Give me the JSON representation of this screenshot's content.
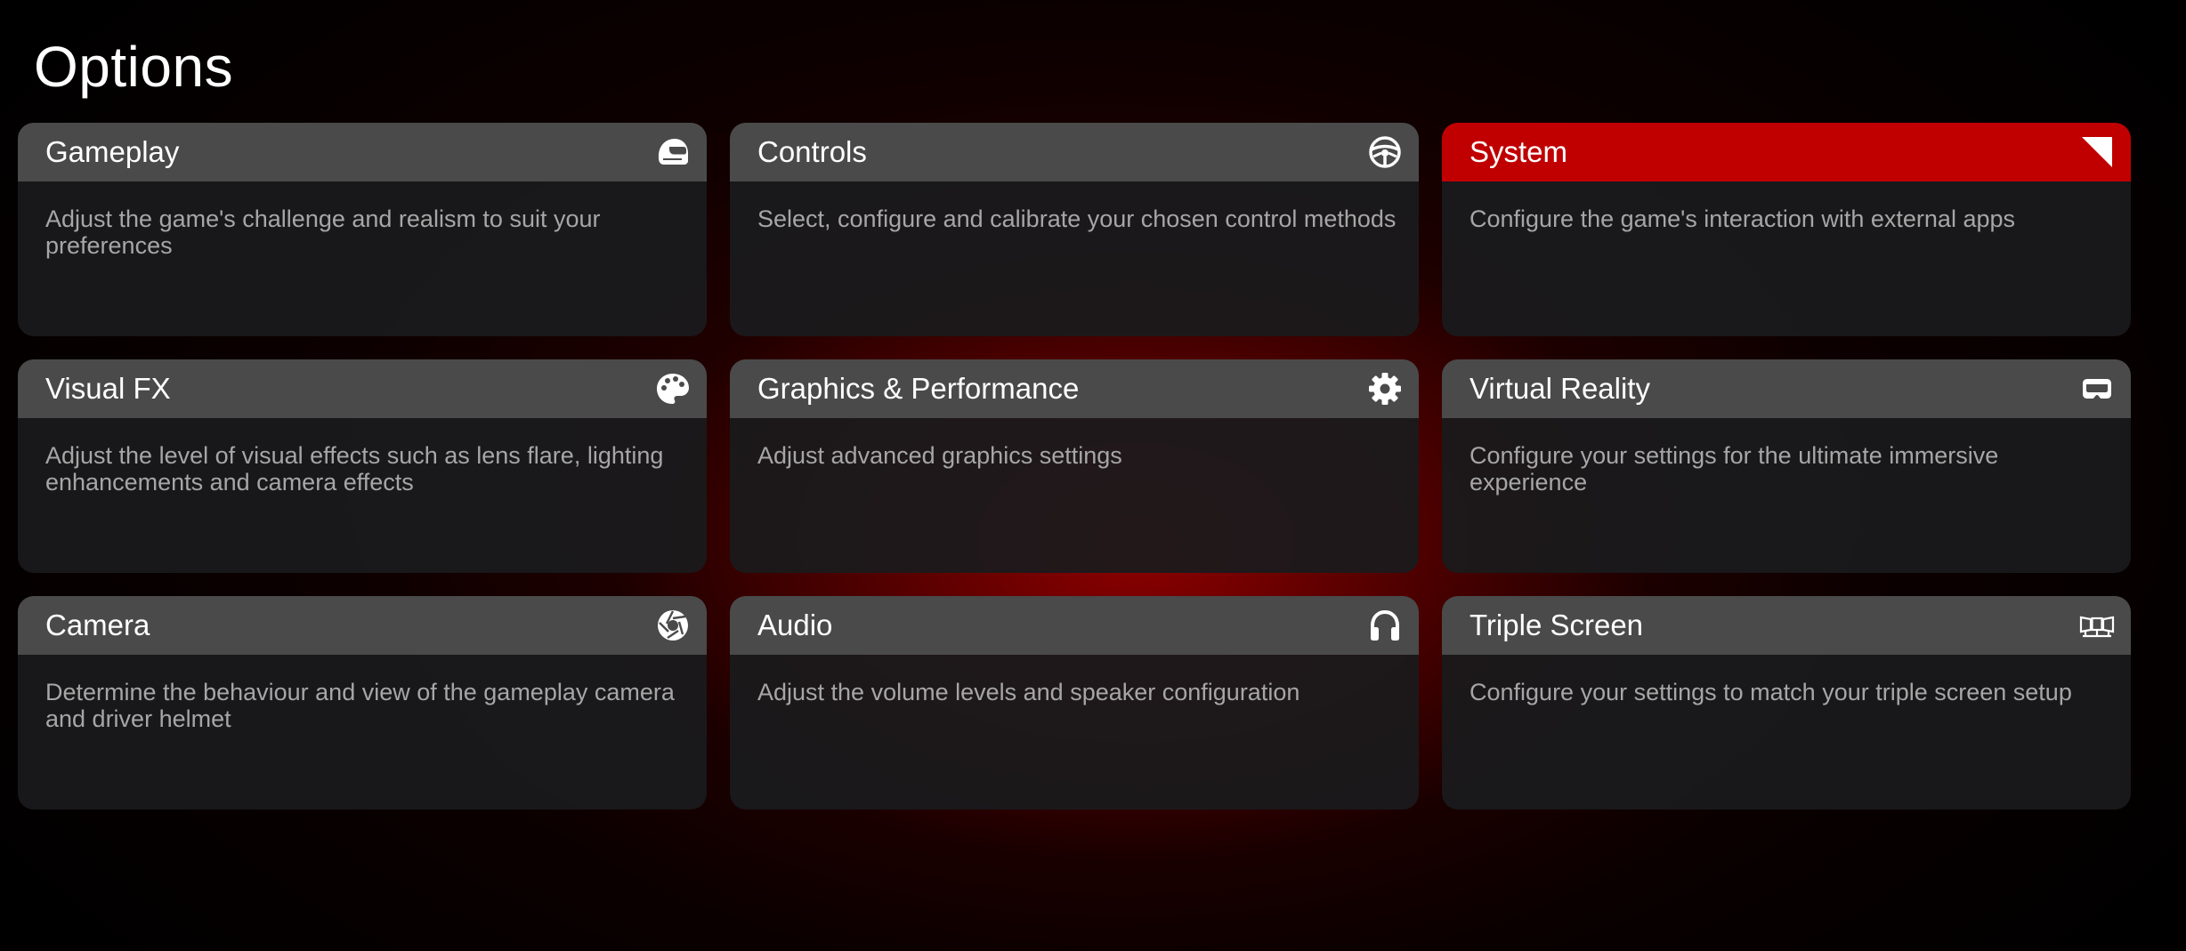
{
  "page": {
    "title": "Options"
  },
  "colors": {
    "selected_header": "#c00000",
    "header": "#4a4a4a",
    "card_body": "#1a1a1c",
    "description_text": "#a6a6a6"
  },
  "cards": [
    {
      "title": "Gameplay",
      "icon": "helmet-icon",
      "description": "Adjust the game's challenge and realism to suit your preferences",
      "selected": false
    },
    {
      "title": "Controls",
      "icon": "steering-wheel-icon",
      "description": "Select, configure and calibrate your chosen control methods",
      "selected": false
    },
    {
      "title": "System",
      "icon": "corner-triangle-icon",
      "description": "Configure the game's interaction with external apps",
      "selected": true
    },
    {
      "title": "Visual FX",
      "icon": "palette-icon",
      "description": "Adjust the level of visual effects such as lens flare, lighting enhancements and camera effects",
      "selected": false
    },
    {
      "title": "Graphics & Performance",
      "icon": "gear-icon",
      "description": "Adjust advanced graphics settings",
      "selected": false
    },
    {
      "title": "Virtual Reality",
      "icon": "vr-headset-icon",
      "description": "Configure your settings for the ultimate immersive experience",
      "selected": false
    },
    {
      "title": "Camera",
      "icon": "aperture-icon",
      "description": "Determine the behaviour and view of the gameplay camera and driver helmet",
      "selected": false
    },
    {
      "title": "Audio",
      "icon": "headphones-icon",
      "description": "Adjust the volume levels and speaker configuration",
      "selected": false
    },
    {
      "title": "Triple Screen",
      "icon": "triple-monitor-icon",
      "description": "Configure your settings to match your triple screen setup",
      "selected": false
    }
  ]
}
